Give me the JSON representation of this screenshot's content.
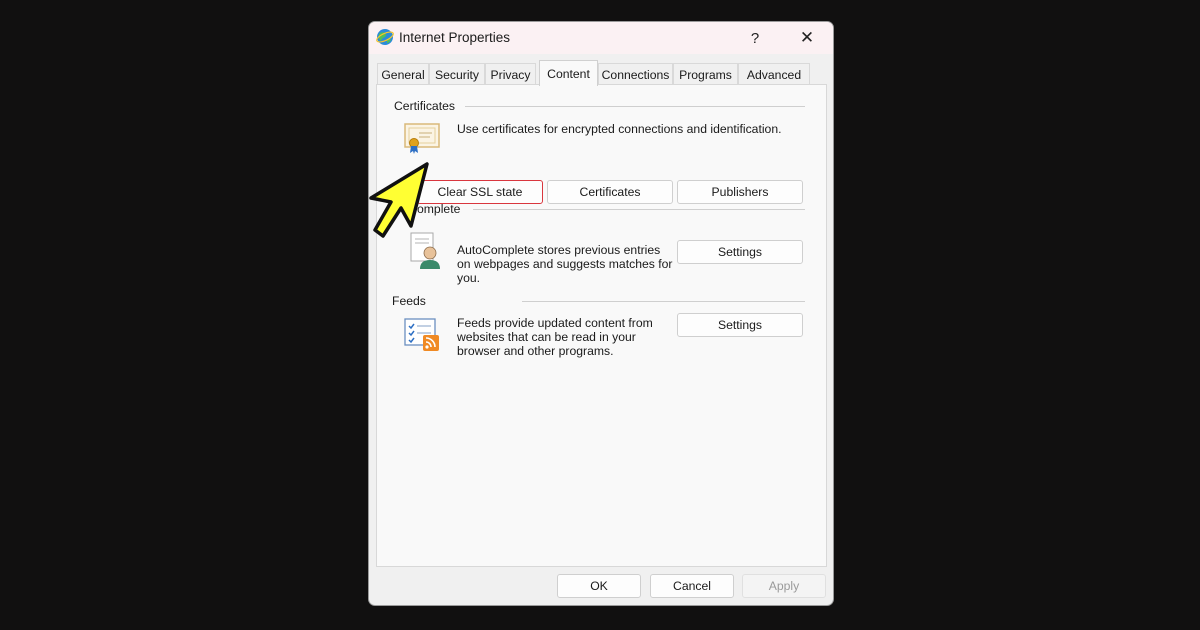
{
  "window": {
    "title": "Internet Properties",
    "help_glyph": "?",
    "close_glyph": "✕"
  },
  "tabs": [
    {
      "label": "General"
    },
    {
      "label": "Security"
    },
    {
      "label": "Privacy"
    },
    {
      "label": "Content",
      "active": true
    },
    {
      "label": "Connections"
    },
    {
      "label": "Programs"
    },
    {
      "label": "Advanced"
    }
  ],
  "certificates": {
    "group_label": "Certificates",
    "description": "Use certificates for encrypted connections and identification.",
    "clear_ssl_label": "Clear SSL state",
    "certificates_label": "Certificates",
    "publishers_label": "Publishers"
  },
  "autocomplete": {
    "group_label": "omplete",
    "description_lines": [
      "AutoComplete stores previous entries",
      "on webpages and suggests matches for",
      "you."
    ],
    "settings_label": "Settings"
  },
  "feeds": {
    "group_label": "Feeds",
    "description_lines": [
      "Feeds provide updated content from",
      "websites that can be read in your",
      "browser and other programs."
    ],
    "settings_label": "Settings"
  },
  "footer": {
    "ok_label": "OK",
    "cancel_label": "Cancel",
    "apply_label": "Apply"
  },
  "colors": {
    "highlight": "#d9363e",
    "cursor_fill": "#ffff33",
    "background": "#111010"
  }
}
